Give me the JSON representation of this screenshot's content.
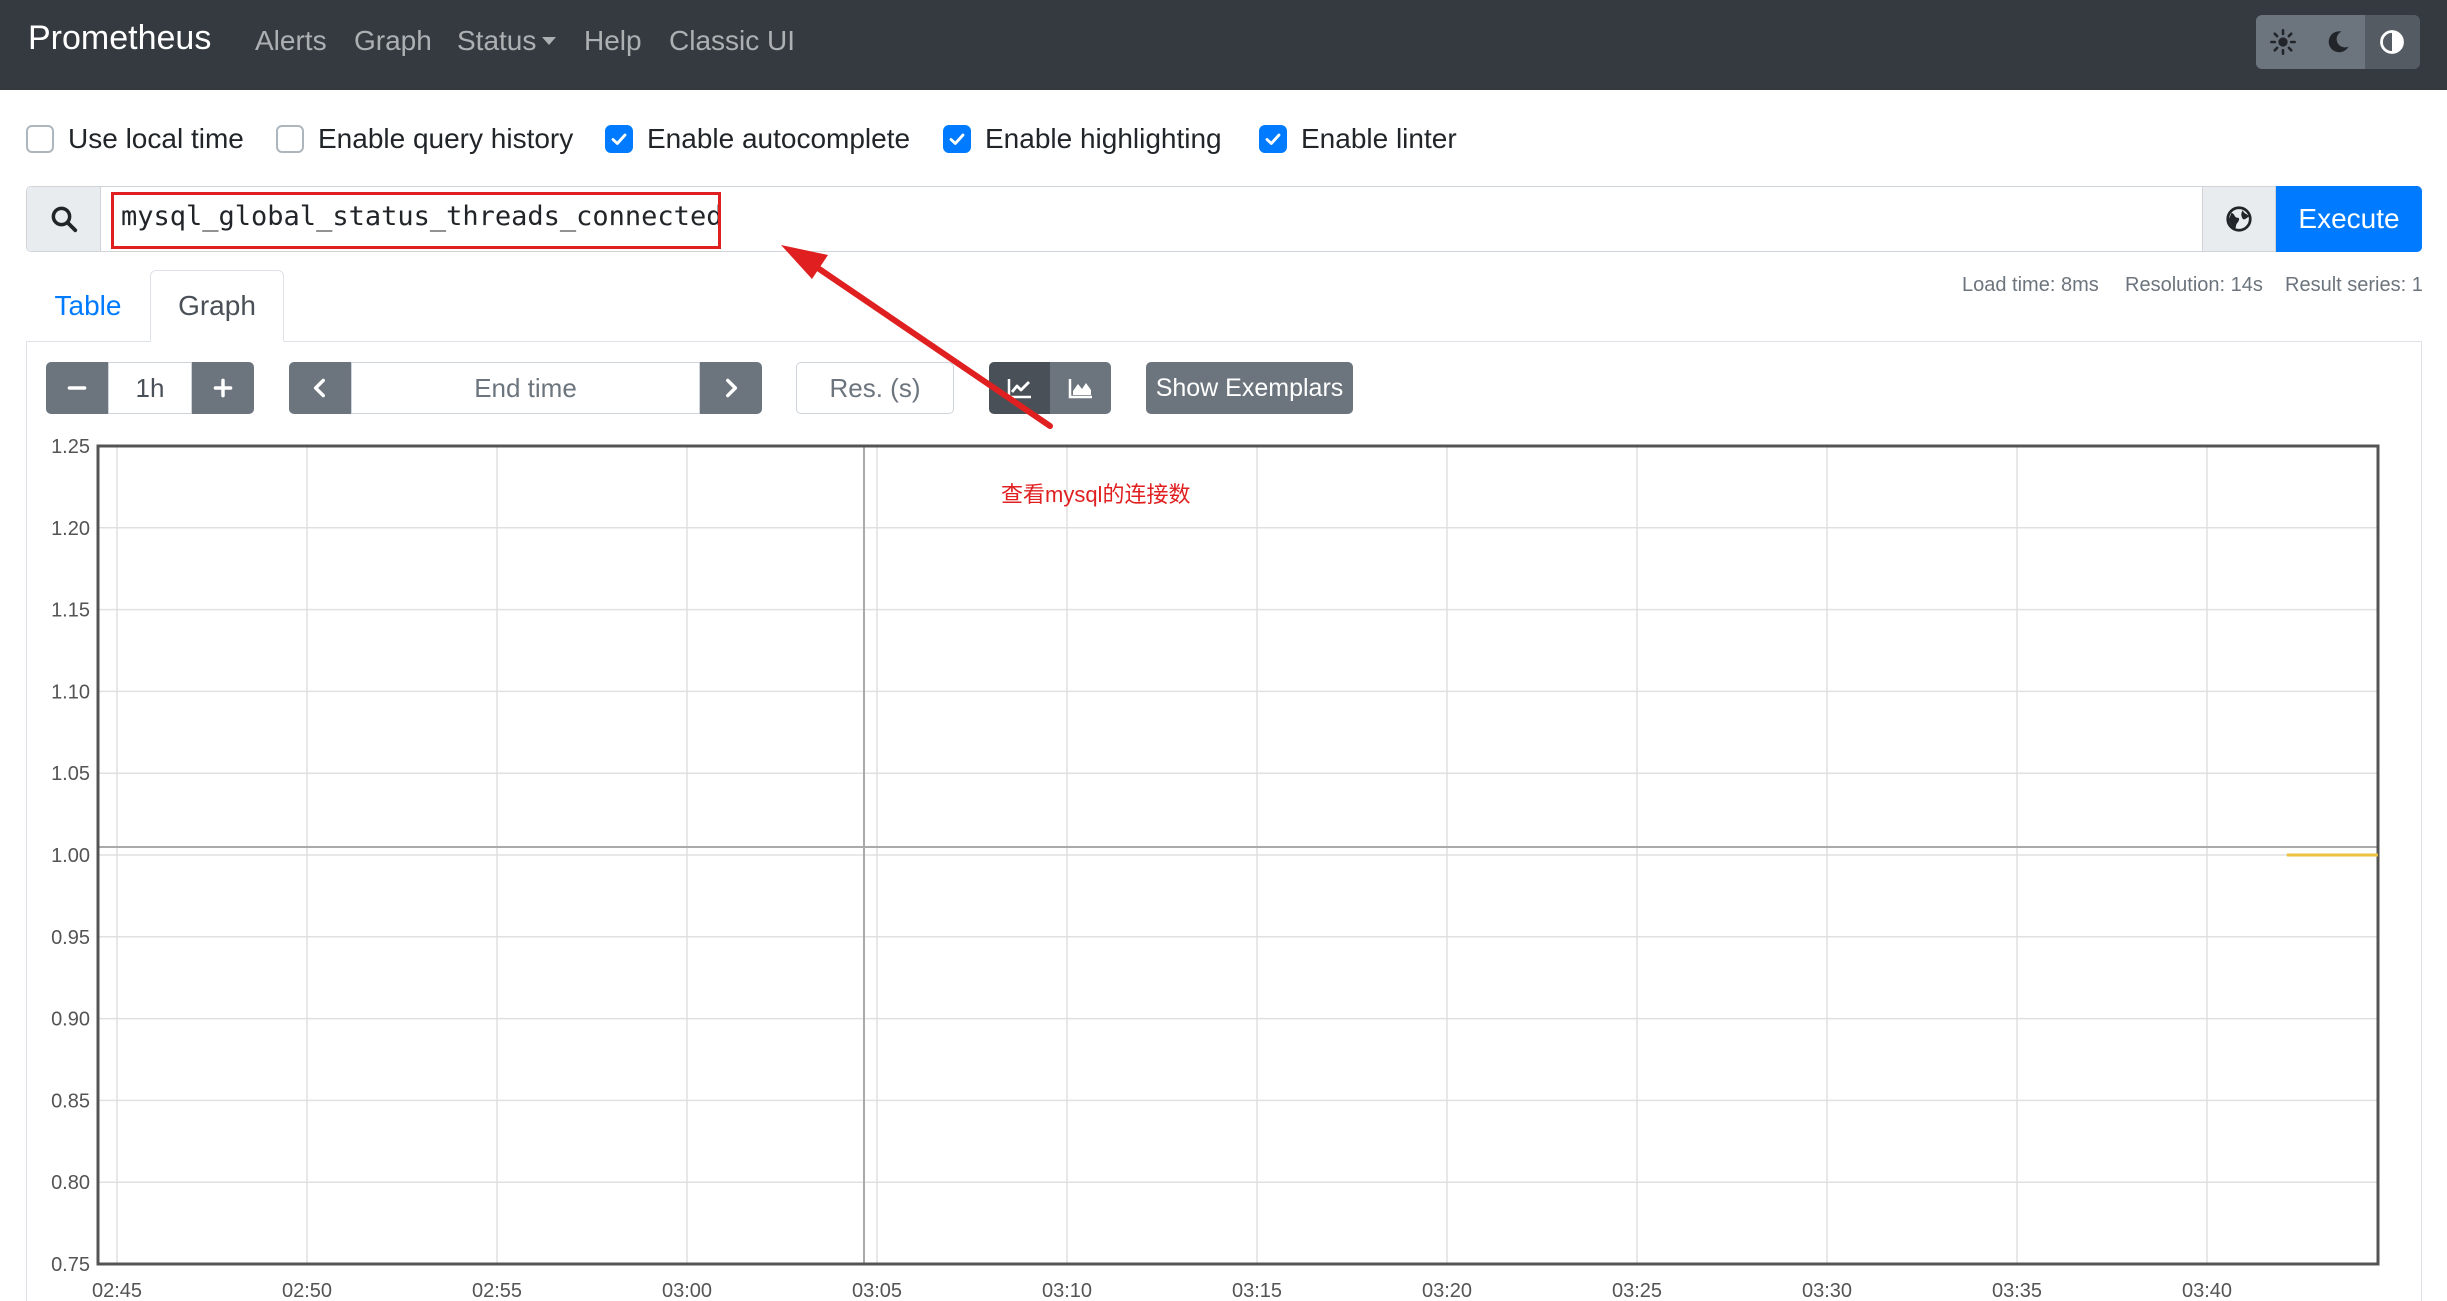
{
  "navbar": {
    "brand": "Prometheus",
    "links": [
      "Alerts",
      "Graph",
      "Status",
      "Help",
      "Classic UI"
    ],
    "theme_icons": [
      "sun-icon",
      "moon-icon",
      "contrast-icon"
    ]
  },
  "options": [
    {
      "label": "Use local time",
      "checked": false
    },
    {
      "label": "Enable query history",
      "checked": false
    },
    {
      "label": "Enable autocomplete",
      "checked": true
    },
    {
      "label": "Enable highlighting",
      "checked": true
    },
    {
      "label": "Enable linter",
      "checked": true
    }
  ],
  "query": {
    "value": "mysql_global_status_threads_connected",
    "execute_label": "Execute"
  },
  "tabs": {
    "table": "Table",
    "graph": "Graph"
  },
  "stats": {
    "load_time": "Load time: 8ms",
    "resolution": "Resolution: 14s",
    "result_series": "Result series: 1"
  },
  "controls": {
    "range": "1h",
    "end_time_placeholder": "End time",
    "res_placeholder": "Res. (s)",
    "show_exemplars": "Show Exemplars"
  },
  "annotation": "查看mysql的连接数",
  "colors": {
    "accent": "#007bff",
    "navbar": "#343a40",
    "series": "#edc240",
    "annotation": "#e02020"
  },
  "chart_data": {
    "type": "line",
    "xlabel": "",
    "ylabel": "",
    "y_ticks": [
      "1.25",
      "1.20",
      "1.15",
      "1.10",
      "1.05",
      "1.00",
      "0.95",
      "0.90",
      "0.85",
      "0.80",
      "0.75"
    ],
    "ylim": [
      0.75,
      1.25
    ],
    "x_ticks": [
      "02:45",
      "02:50",
      "02:55",
      "03:00",
      "03:05",
      "03:10",
      "03:15",
      "03:20",
      "03:25",
      "03:30",
      "03:35",
      "03:40"
    ],
    "x_tick_minutes": [
      165,
      170,
      175,
      180,
      185,
      190,
      195,
      200,
      205,
      210,
      215,
      220
    ],
    "xlim_minutes": [
      164.5,
      224.5
    ],
    "grid": true,
    "series": [
      {
        "name": "",
        "color": "#edc240",
        "points": [
          [
            222.1,
            1.0
          ],
          [
            224.5,
            1.0
          ]
        ]
      }
    ]
  }
}
